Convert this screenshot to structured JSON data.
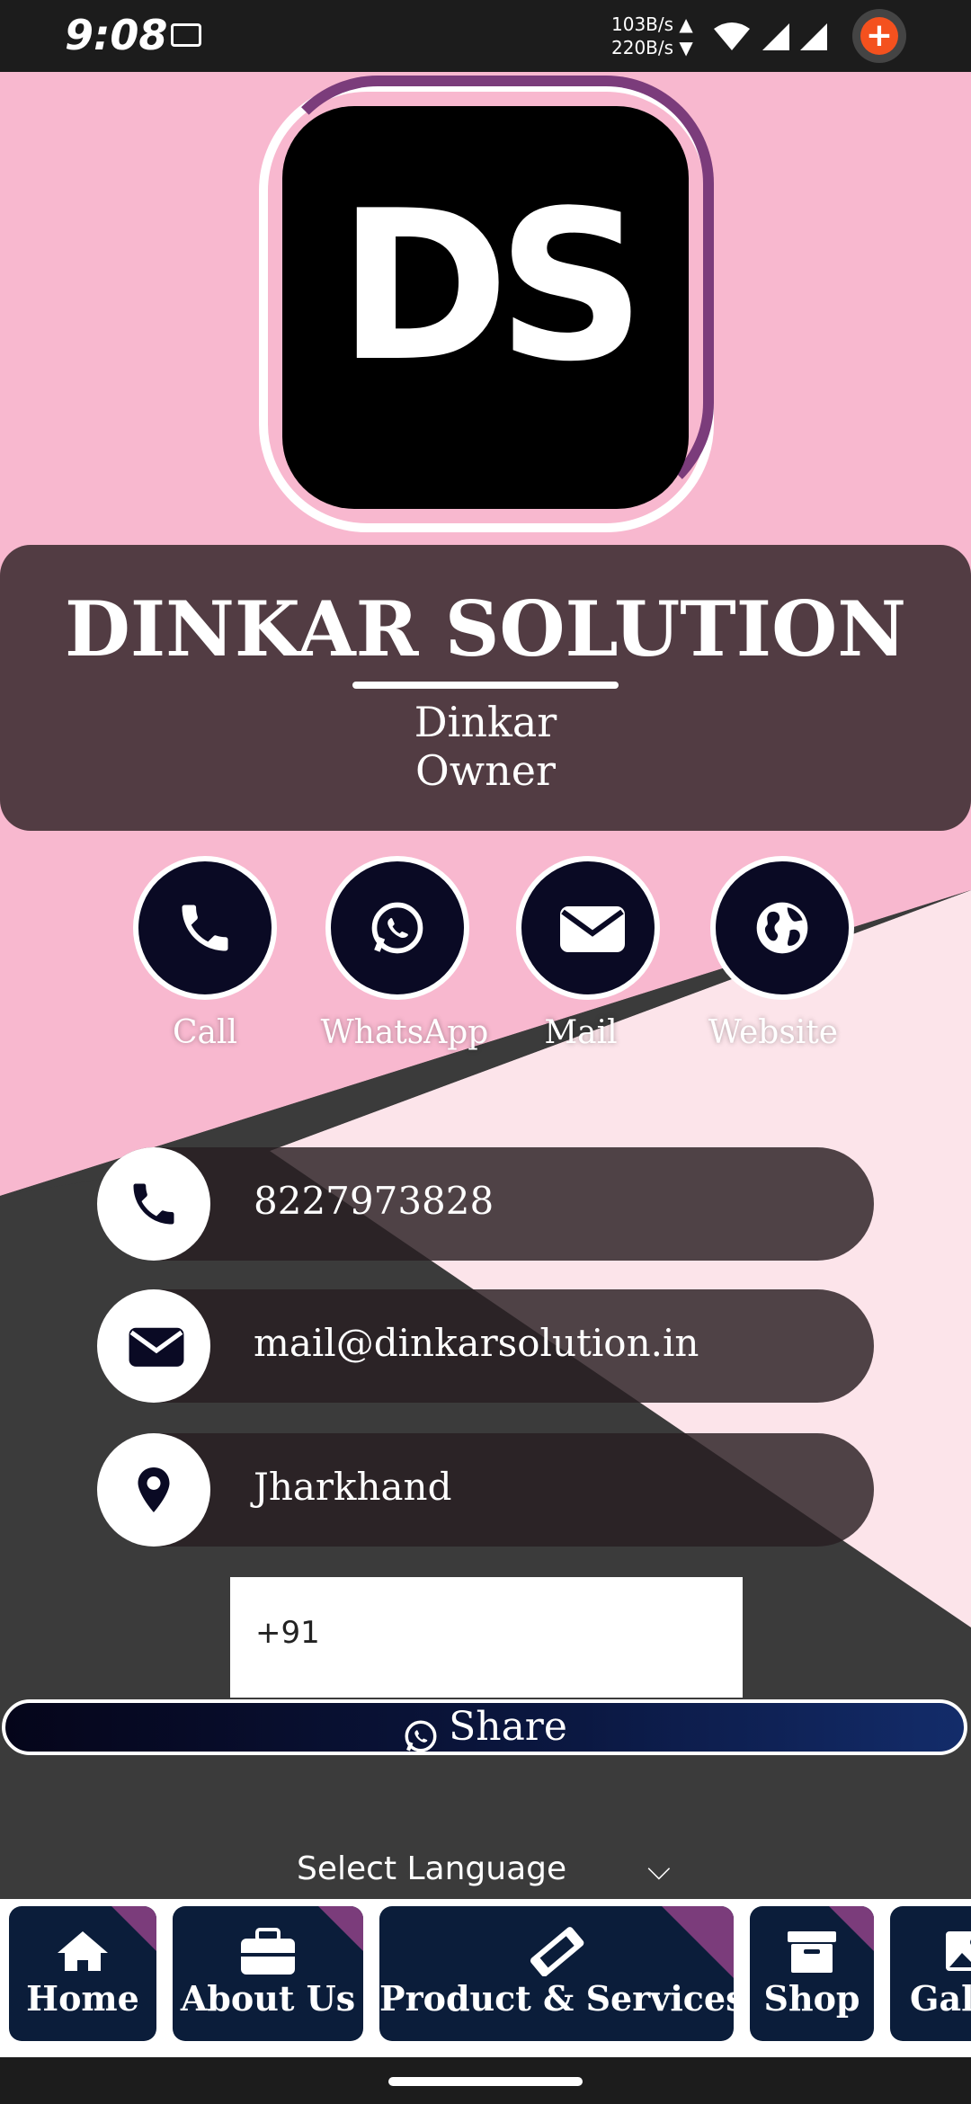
{
  "status_bar": {
    "time": "9:08",
    "net_up": "103B/s ▲",
    "net_down": "220B/s ▼",
    "record_symbol": "+"
  },
  "company": "DINKAR SOLUTION",
  "logo_text": "DS",
  "person_name": "Dinkar",
  "person_role": "Owner",
  "actions": [
    {
      "label": "Call",
      "icon": "phone-icon"
    },
    {
      "label": "WhatsApp",
      "icon": "whatsapp-icon"
    },
    {
      "label": "Mail",
      "icon": "mail-icon"
    },
    {
      "label": "Website",
      "icon": "globe-icon"
    }
  ],
  "contacts": {
    "phone": "8227973828",
    "email": "mail@dinkarsolution.in",
    "location": "Jharkhand"
  },
  "phone_input": {
    "prefix": "+91"
  },
  "share_label": "Share",
  "language": {
    "label": "Select Language",
    "chevron": "⌵"
  },
  "nav": [
    {
      "label": "Home",
      "icon": "home-icon"
    },
    {
      "label": "About Us",
      "icon": "briefcase-icon"
    },
    {
      "label": "Product & Services",
      "icon": "ticket-icon"
    },
    {
      "label": "Shop",
      "icon": "archive-icon"
    },
    {
      "label": "Gall",
      "icon": "image-icon"
    }
  ],
  "colors": {
    "pink": "#f8b8cf",
    "light_pink": "#fce4ea",
    "dark": "#3b3b3b",
    "card": "#523c43",
    "navy": "#0b1d3a",
    "accent_purple": "#7b3c7b"
  }
}
